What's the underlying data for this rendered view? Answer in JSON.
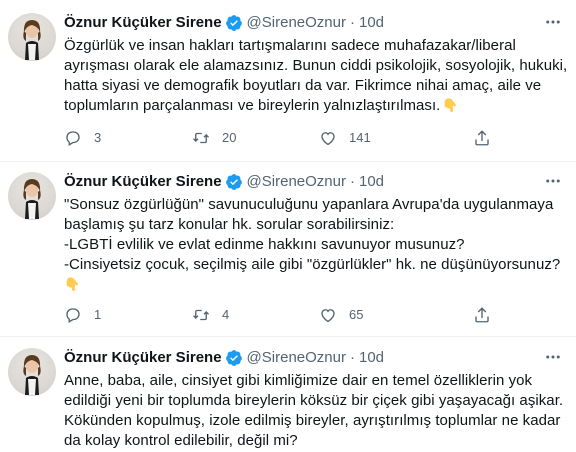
{
  "icons": {
    "verified": "verified-badge-icon",
    "more": "more-options-icon",
    "reply": "reply-icon",
    "retweet": "retweet-icon",
    "like": "heart-icon",
    "share": "share-icon",
    "emoji": "backhand-index-pointing-down-emoji"
  },
  "colors": {
    "verified": "#1d9bf0",
    "secondary_text": "#536471",
    "primary_text": "#0f1419",
    "divider": "#eff3f4"
  },
  "tweets": [
    {
      "author": {
        "name": "Öznur Küçüker Sirene",
        "handle": "@SireneOznur",
        "separator": "·",
        "time": "10d"
      },
      "lines": [
        "Özgürlük ve insan hakları tartışmalarını sadece muhafazakar/liberal",
        "ayrışması olarak ele alamazsınız. Bunun ciddi psikolojik, sosyolojik, hukuki,",
        "hatta siyasi ve demografik boyutları da var. Fikrimce nihai amaç, aile ve",
        "toplumların parçalanması ve bireylerin yalnızlaştırılması."
      ],
      "stats": {
        "replies": "3",
        "retweets": "20",
        "likes": "141"
      }
    },
    {
      "author": {
        "name": "Öznur Küçüker Sirene",
        "handle": "@SireneOznur",
        "separator": "·",
        "time": "10d"
      },
      "lines": [
        "\"Sonsuz özgürlüğün\" savunuculuğunu yapanlara Avrupa'da uygulanmaya",
        "başlamış şu tarz konular hk. sorular sorabilirsiniz:",
        "-LGBTİ evlilik ve evlat edinme hakkını savunuyor musunuz?",
        "-Cinsiyetsiz çocuk, seçilmiş aile gibi \"özgürlükler\" hk. ne düşünüyorsunuz?"
      ],
      "stats": {
        "replies": "1",
        "retweets": "4",
        "likes": "65"
      }
    },
    {
      "author": {
        "name": "Öznur Küçüker Sirene",
        "handle": "@SireneOznur",
        "separator": "·",
        "time": "10d"
      },
      "lines": [
        "Anne, baba, aile, cinsiyet gibi kimliğimize dair en temel özelliklerin yok",
        "edildiği yeni bir toplumda bireylerin köksüz bir çiçek gibi yaşayacağı aşikar.",
        "Kökünden kopulmuş, izole edilmiş bireyler, ayrıştırılmış toplumlar ne kadar",
        "da kolay kontrol edilebilir, değil mi?"
      ]
    }
  ]
}
